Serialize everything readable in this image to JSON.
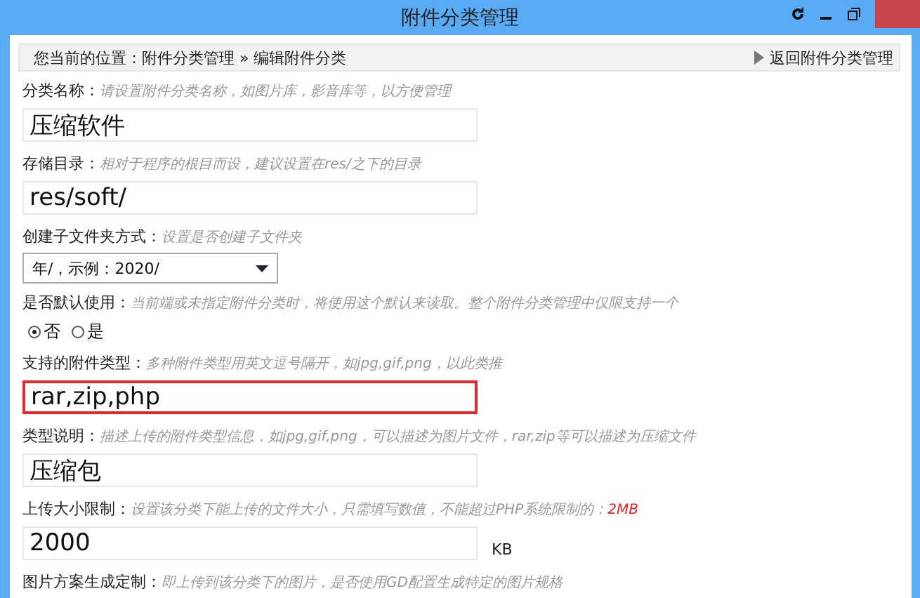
{
  "window": {
    "title": "附件分类管理"
  },
  "breadcrumb": {
    "text": "您当前的位置：附件分类管理 » 编辑附件分类",
    "back_link": "返回附件分类管理"
  },
  "fields": [
    {
      "kind": "text",
      "label": "分类名称：",
      "hint": "请设置附件分类名称，如图片库，影音库等，以方便管理",
      "value": "压缩软件"
    },
    {
      "kind": "text",
      "label": "存储目录：",
      "hint": "相对于程序的根目而设，建议设置在res/之下的目录",
      "value": "res/soft/"
    },
    {
      "kind": "select",
      "label": "创建子文件夹方式：",
      "hint": "设置是否创建子文件夹",
      "value": "年/，示例：2020/"
    },
    {
      "kind": "radio",
      "label": "是否默认使用：",
      "hint": "当前端或未指定附件分类时，将使用这个默认来读取。整个附件分类管理中仅限支持一个",
      "options": [
        {
          "label": "否",
          "selected": true
        },
        {
          "label": "是",
          "selected": false
        }
      ]
    },
    {
      "kind": "text",
      "label": "支持的附件类型：",
      "hint": "多种附件类型用英文逗号隔开，如jpg,gif,png，以此类推",
      "value": "rar,zip,php",
      "highlighted": true
    },
    {
      "kind": "text",
      "label": "类型说明：",
      "hint": "描述上传的附件类型信息，如jpg,gif,png，可以描述为图片文件，rar,zip等可以描述为压缩文件",
      "value": "压缩包"
    },
    {
      "kind": "text",
      "label": "上传大小限制：",
      "hint": "设置该分类下能上传的文件大小，只需填写数值，不能超过PHP系统限制的：",
      "hint_emphasis": "2MB",
      "value": "2000",
      "unit": "KB"
    },
    {
      "kind": "heading",
      "label": "图片方案生成定制：",
      "hint": "即上传到该分类下的图片，是否使用GD配置生成特定的图片规格"
    }
  ]
}
